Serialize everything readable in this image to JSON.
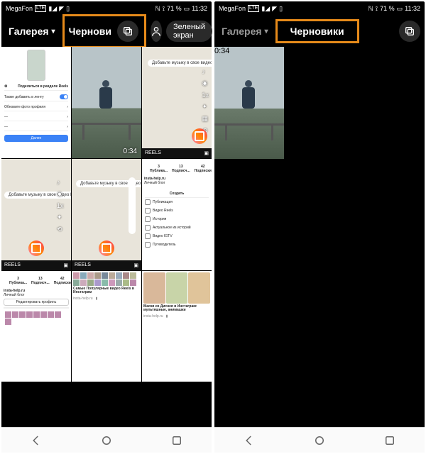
{
  "status": {
    "carrier": "MegaFon",
    "carrier_tag": "LTE",
    "nfc": "NFC",
    "battery": "71 %",
    "time": "11:32"
  },
  "tabs": {
    "gallery": "Галерея",
    "drafts": "Черновики",
    "drafts_trunc": "Чернови",
    "green_screen": "Зеленый экран"
  },
  "video": {
    "duration": "0:34"
  },
  "footer_label": "REELS",
  "mini": {
    "share_header": "Поделиться в разделе Reels",
    "also_feed": "Также добавить в ленту",
    "update_photo": "Обновите фото профиля",
    "done": "Далее",
    "add_music": "Добавьте музыку в свое видео Reels",
    "profile_name": "insta-help.ru",
    "profile_sub": "Личный блог",
    "stats": {
      "posts": "3",
      "followers": "13",
      "following": "42",
      "posts_l": "Публика...",
      "followers_l": "Подписч...",
      "following_l": "Подписки"
    },
    "create": "Создать",
    "menu": {
      "pub": "Публикация",
      "reels": "Видео Reels",
      "story": "История",
      "live": "Актуальное из историй",
      "igtv": "Видео IGTV",
      "guide": "Путеводитель"
    },
    "edit_profile": "Редактировать профиль",
    "article1": "Самые Популярные видео Reels в Инстаграм",
    "article2": "Маски из Диснея в Инстаграм: мультяшные, анимашки"
  }
}
